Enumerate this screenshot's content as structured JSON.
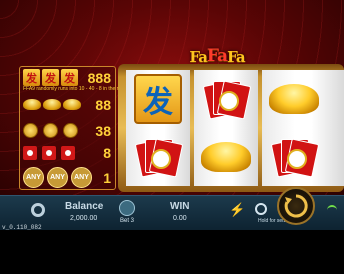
{
  "title": {
    "parts": [
      "Fa",
      "Fa",
      "Fa"
    ]
  },
  "paytable": {
    "rows": [
      {
        "symbols": [
          "发",
          "发",
          "发"
        ],
        "value": "888"
      },
      {
        "symbols": [
          "ingot",
          "ingot",
          "ingot"
        ],
        "value": "88"
      },
      {
        "symbols": [
          "coin",
          "coin",
          "coin"
        ],
        "value": "38"
      },
      {
        "symbols": [
          "envelope",
          "envelope",
          "envelope"
        ],
        "value": "8"
      },
      {
        "symbols": [
          "ANY",
          "ANY",
          "ANY"
        ],
        "value": "1"
      }
    ],
    "note": "FFA9 randomly runs into 10 - 40 - 8 in the middle"
  },
  "reels": {
    "fa_char": "发",
    "layout": [
      [
        "fa",
        "envelope"
      ],
      [
        "envelope",
        "ingot"
      ],
      [
        "ingot",
        "envelope"
      ]
    ]
  },
  "bottom_bar": {
    "balance_label": "Balance",
    "balance_value": "2,000.00",
    "bet_label": "Bet 3",
    "win_label": "WIN",
    "win_value": "0.00",
    "hold_label": "Hold for setting"
  },
  "version": "v_0.110_082",
  "colors": {
    "gold": "#ffc51e",
    "red": "#d11313",
    "bar": "#1c3a4c"
  }
}
